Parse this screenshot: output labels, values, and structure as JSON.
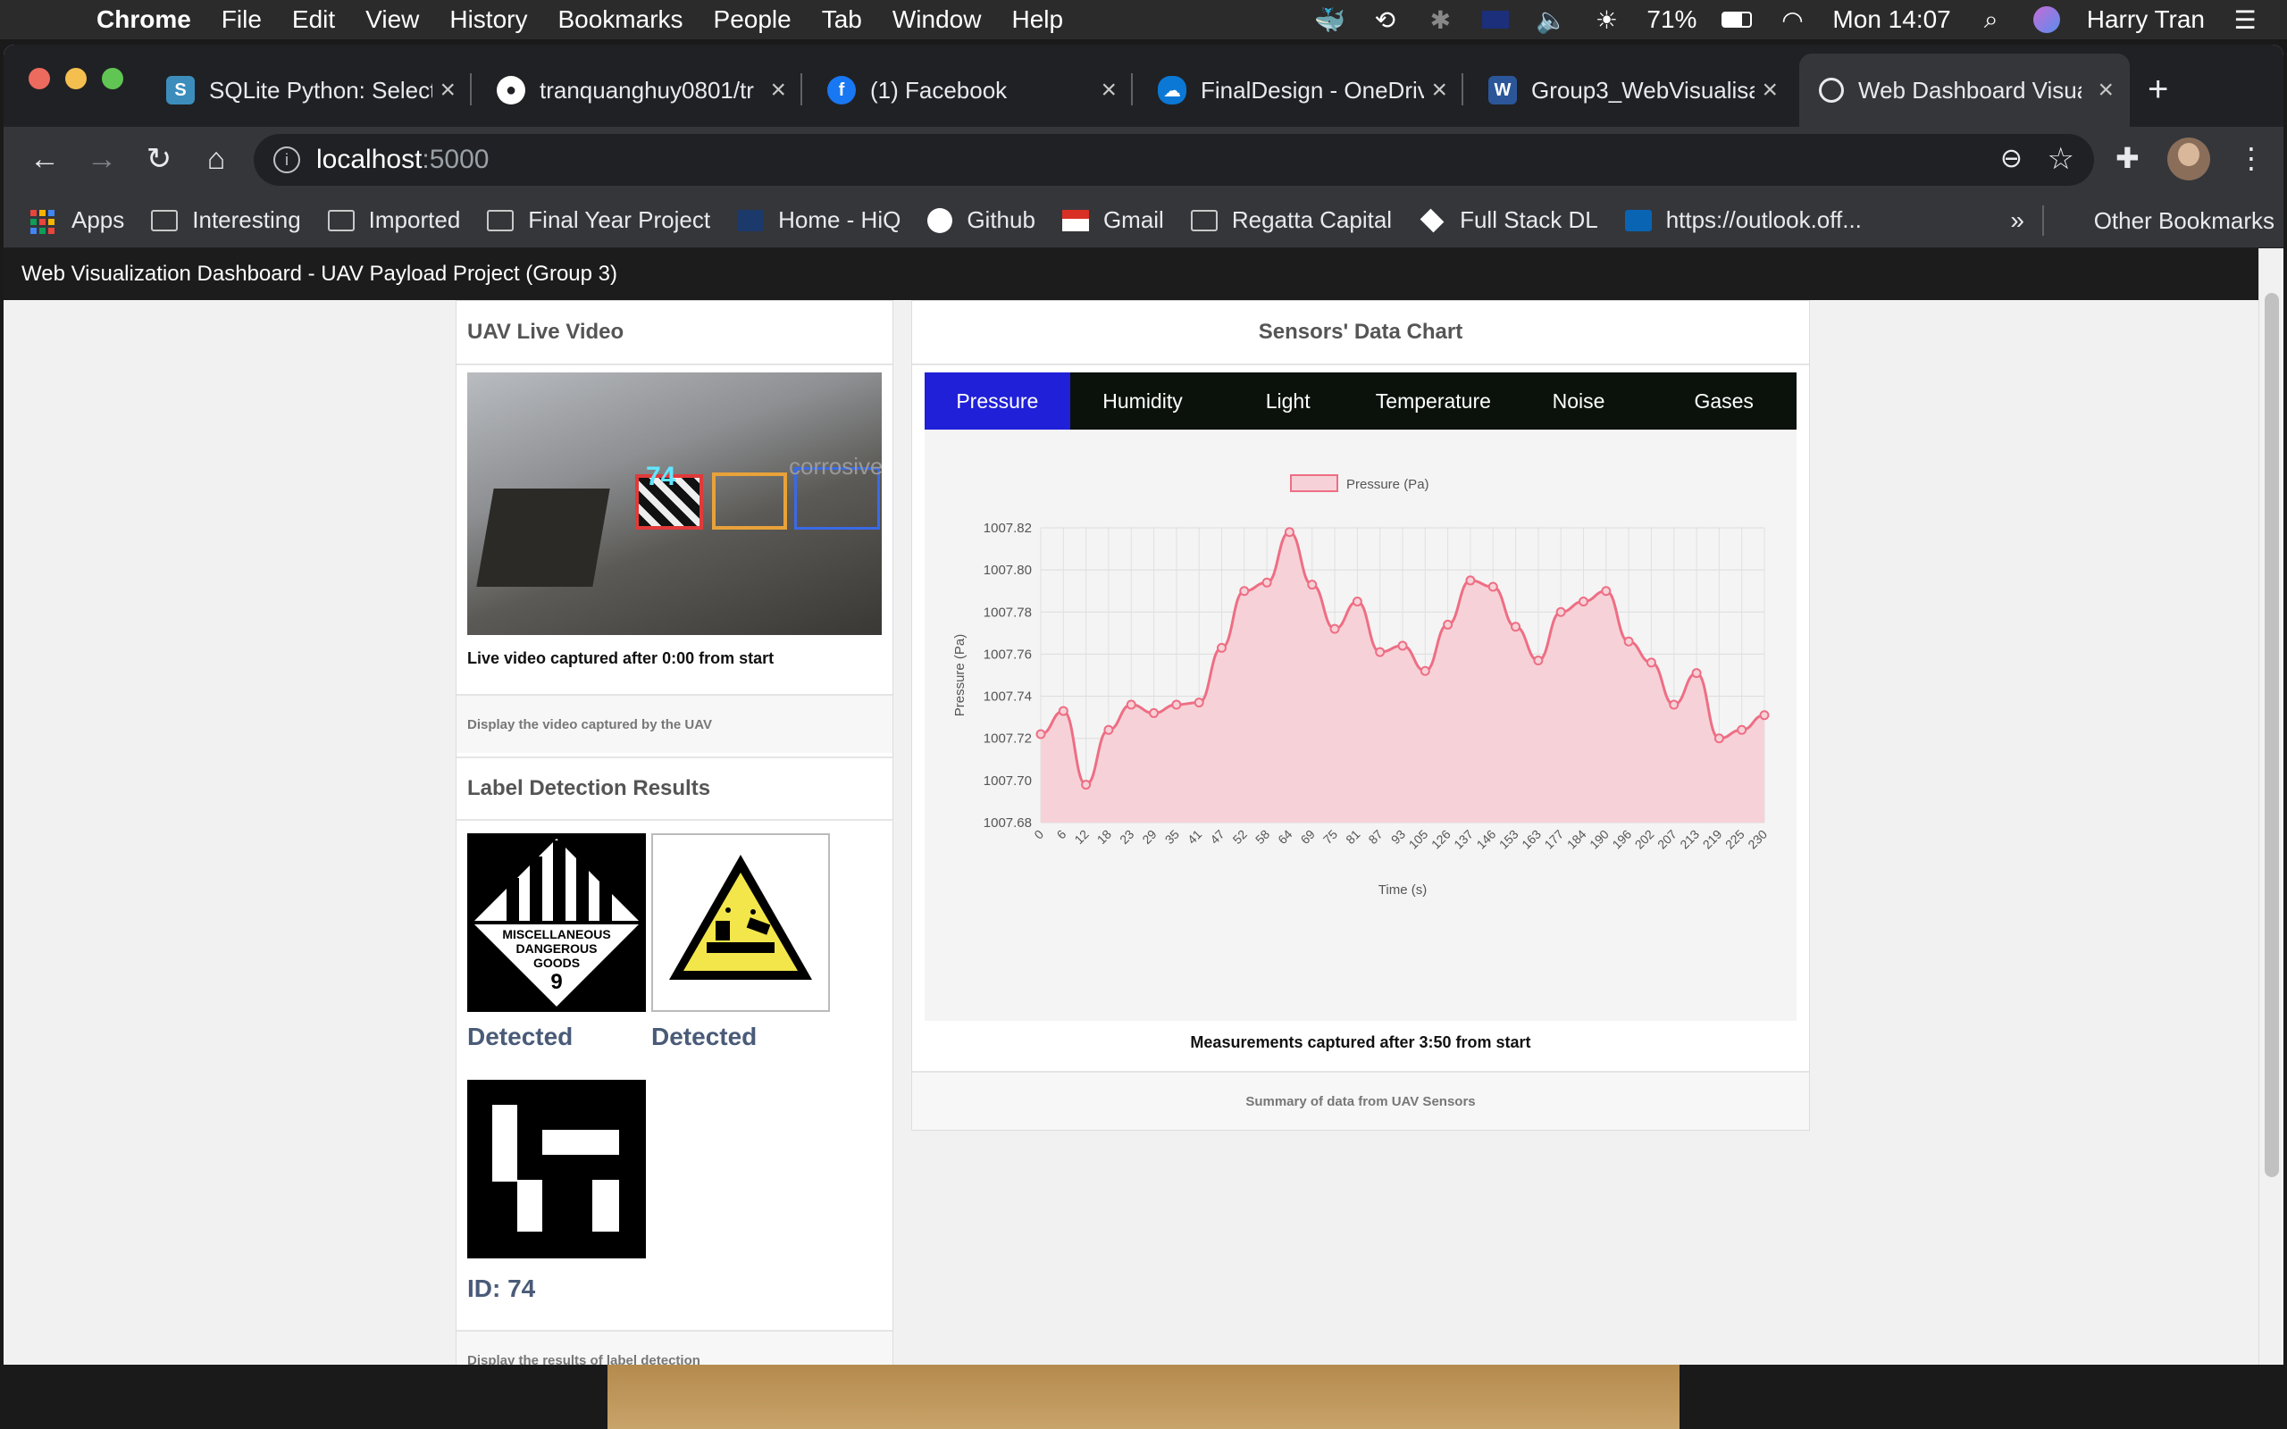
{
  "menubar": {
    "app": "Chrome",
    "items": [
      "File",
      "Edit",
      "View",
      "History",
      "Bookmarks",
      "People",
      "Tab",
      "Window",
      "Help"
    ],
    "battery": "71%",
    "clock": "Mon 14:07",
    "user": "Harry Tran"
  },
  "tabs": [
    {
      "title": "SQLite Python: Select",
      "icon": "sqlite-icon",
      "color": "#3c8dbc"
    },
    {
      "title": "tranquanghuy0801/tr",
      "icon": "github-icon",
      "color": "#ffffff"
    },
    {
      "title": "(1) Facebook",
      "icon": "facebook-icon",
      "color": "#1877f2"
    },
    {
      "title": "FinalDesign - OneDriv",
      "icon": "onedrive-icon",
      "color": "#0a78d4"
    },
    {
      "title": "Group3_WebVisualisa",
      "icon": "word-icon",
      "color": "#2b579a"
    },
    {
      "title": "Web Dashboard Visua",
      "icon": "globe-icon",
      "color": "#e8eaed"
    }
  ],
  "omnibox": {
    "host": "localhost",
    "port": ":5000"
  },
  "bookmarks": [
    {
      "label": "Apps",
      "icon": "apps-grid-icon"
    },
    {
      "label": "Interesting",
      "icon": "folder-icon"
    },
    {
      "label": "Imported",
      "icon": "folder-icon"
    },
    {
      "label": "Final Year Project",
      "icon": "folder-icon"
    },
    {
      "label": "Home - HiQ",
      "icon": "qut-icon"
    },
    {
      "label": "Github",
      "icon": "github-icon"
    },
    {
      "label": "Gmail",
      "icon": "gmail-icon"
    },
    {
      "label": "Regatta Capital",
      "icon": "folder-icon"
    },
    {
      "label": "Full Stack DL",
      "icon": "fsdl-icon"
    },
    {
      "label": "https://outlook.off...",
      "icon": "outlook-icon"
    }
  ],
  "bookmarks_more": "»",
  "bookmarks_other": "Other Bookmarks",
  "dashboard": {
    "title": "Web Visualization Dashboard - UAV Payload Project (Group 3)",
    "video": {
      "heading": "UAV Live Video",
      "overlay_id": "74",
      "overlay_label": "corrosive",
      "caption": "Live video captured after 0:00 from start",
      "footer": "Display the video captured by the UAV"
    },
    "detection": {
      "heading": "Label Detection Results",
      "sign1_text": [
        "MISCELLANEOUS",
        "DANGEROUS",
        "GOODS",
        "9"
      ],
      "status1": "Detected",
      "status2": "Detected",
      "marker_id": "ID: 74",
      "footer": "Display the results of label detection"
    },
    "chart_panel": {
      "heading": "Sensors' Data Chart",
      "tabs": [
        "Pressure",
        "Humidity",
        "Light",
        "Temperature",
        "Noise",
        "Gases"
      ],
      "active_tab": "Pressure",
      "caption": "Measurements captured after 3:50 from start",
      "footer": "Summary of data from UAV Sensors"
    }
  },
  "chart_data": {
    "type": "area",
    "xlabel": "Time (s)",
    "ylabel": "Pressure (Pa)",
    "series": [
      {
        "name": "Pressure (Pa)",
        "color": "#ee6e84",
        "fill": "#f6d2d8",
        "x": [
          0,
          6,
          12,
          18,
          23,
          29,
          35,
          41,
          47,
          52,
          58,
          64,
          69,
          75,
          81,
          87,
          93,
          105,
          126,
          137,
          146,
          153,
          163,
          177,
          184,
          190,
          196,
          202,
          207,
          213,
          219,
          225,
          230
        ],
        "values": [
          1007.722,
          1007.733,
          1007.698,
          1007.724,
          1007.736,
          1007.732,
          1007.736,
          1007.737,
          1007.763,
          1007.79,
          1007.794,
          1007.818,
          1007.793,
          1007.772,
          1007.785,
          1007.761,
          1007.764,
          1007.752,
          1007.774,
          1007.795,
          1007.792,
          1007.773,
          1007.757,
          1007.78,
          1007.785,
          1007.79,
          1007.766,
          1007.756,
          1007.736,
          1007.751,
          1007.72,
          1007.724,
          1007.731
        ]
      }
    ],
    "yticks": [
      "1007.82",
      "1007.80",
      "1007.78",
      "1007.76",
      "1007.74",
      "1007.72",
      "1007.70",
      "1007.68"
    ],
    "ylim": [
      1007.68,
      1007.82
    ],
    "grid": true,
    "legend": "top"
  }
}
